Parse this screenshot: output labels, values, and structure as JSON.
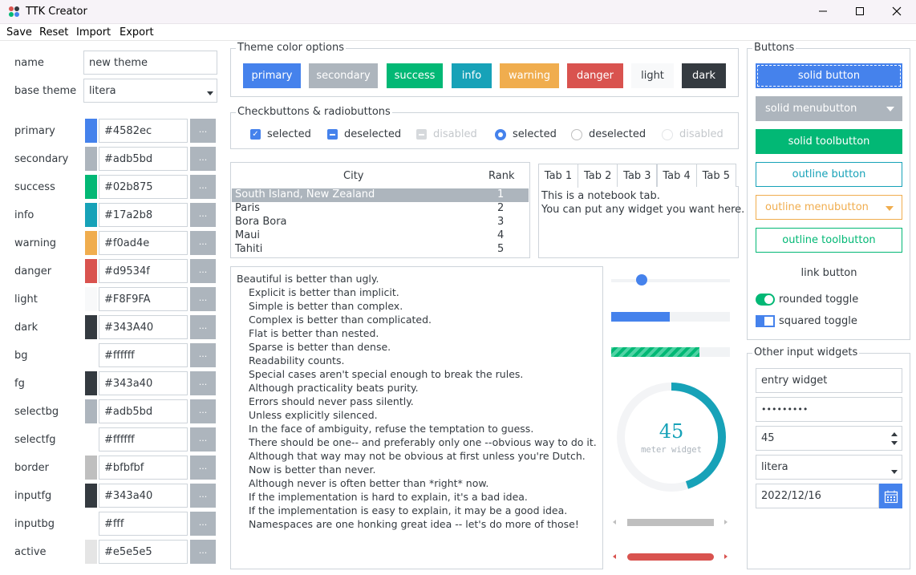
{
  "window": {
    "title": "TTK Creator",
    "icon": "ttk-creator-logo-icon"
  },
  "menu": [
    "Save",
    "Reset",
    "Import",
    "Export"
  ],
  "form": {
    "name_label": "name",
    "name_value": "new theme",
    "base_label": "base theme",
    "base_value": "litera",
    "more_label": "...",
    "colors": [
      {
        "label": "primary",
        "value": "#4582ec",
        "swatch": "#4582ec"
      },
      {
        "label": "secondary",
        "value": "#adb5bd",
        "swatch": "#adb5bd"
      },
      {
        "label": "success",
        "value": "#02b875",
        "swatch": "#02b875"
      },
      {
        "label": "info",
        "value": "#17a2b8",
        "swatch": "#17a2b8"
      },
      {
        "label": "warning",
        "value": "#f0ad4e",
        "swatch": "#f0ad4e"
      },
      {
        "label": "danger",
        "value": "#d9534f",
        "swatch": "#d9534f"
      },
      {
        "label": "light",
        "value": "#F8F9FA",
        "swatch": "#F8F9FA"
      },
      {
        "label": "dark",
        "value": "#343A40",
        "swatch": "#343A40"
      },
      {
        "label": "bg",
        "value": "#ffffff",
        "swatch": "#ffffff"
      },
      {
        "label": "fg",
        "value": "#343a40",
        "swatch": "#343a40"
      },
      {
        "label": "selectbg",
        "value": "#adb5bd",
        "swatch": "#adb5bd"
      },
      {
        "label": "selectfg",
        "value": "#ffffff",
        "swatch": "#ffffff"
      },
      {
        "label": "border",
        "value": "#bfbfbf",
        "swatch": "#bfbfbf"
      },
      {
        "label": "inputfg",
        "value": "#343a40",
        "swatch": "#343a40"
      },
      {
        "label": "inputbg",
        "value": "#fff",
        "swatch": "#ffffff"
      },
      {
        "label": "active",
        "value": "#e5e5e5",
        "swatch": "#e5e5e5"
      }
    ]
  },
  "theme_colors": {
    "title": "Theme color options",
    "buttons": [
      {
        "label": "primary",
        "bg": "#4582ec",
        "fg": "#ffffff"
      },
      {
        "label": "secondary",
        "bg": "#adb5bd",
        "fg": "#ffffff"
      },
      {
        "label": "success",
        "bg": "#02b875",
        "fg": "#ffffff"
      },
      {
        "label": "info",
        "bg": "#17a2b8",
        "fg": "#ffffff"
      },
      {
        "label": "warning",
        "bg": "#f0ad4e",
        "fg": "#ffffff"
      },
      {
        "label": "danger",
        "bg": "#d9534f",
        "fg": "#ffffff"
      },
      {
        "label": "light",
        "bg": "#F8F9FA",
        "fg": "#343a40"
      },
      {
        "label": "dark",
        "bg": "#343A40",
        "fg": "#ffffff"
      }
    ]
  },
  "checks": {
    "title": "Checkbuttons & radiobuttons",
    "items": [
      {
        "label": "selected",
        "state": "checked"
      },
      {
        "label": "deselected",
        "state": "indeterminate"
      },
      {
        "label": "disabled",
        "state": "disabled"
      },
      {
        "label": "selected",
        "state": "radio-on"
      },
      {
        "label": "deselected",
        "state": "radio-off"
      },
      {
        "label": "disabled",
        "state": "radio-disabled"
      }
    ]
  },
  "table": {
    "columns": [
      "City",
      "Rank"
    ],
    "rows": [
      {
        "city": "South Island, New Zealand",
        "rank": "1",
        "selected": true
      },
      {
        "city": "Paris",
        "rank": "2"
      },
      {
        "city": "Bora Bora",
        "rank": "3"
      },
      {
        "city": "Maui",
        "rank": "4"
      },
      {
        "city": "Tahiti",
        "rank": "5"
      }
    ]
  },
  "notebook": {
    "tabs": [
      "Tab 1",
      "Tab 2",
      "Tab 3",
      "Tab 4",
      "Tab 5"
    ],
    "line1": "This is a notebook tab.",
    "line2": "You can put any widget you want here."
  },
  "zen": [
    "Beautiful is better than ugly.",
    "Explicit is better than implicit.",
    "Simple is better than complex.",
    "Complex is better than complicated.",
    "Flat is better than nested.",
    "Sparse is better than dense.",
    "Readability counts.",
    "Special cases aren't special enough to break the rules.",
    "Although practicality beats purity.",
    "Errors should never pass silently.",
    "Unless explicitly silenced.",
    "In the face of ambiguity, refuse the temptation to guess.",
    "There should be one-- and preferably only one --obvious way to do it.",
    "Although that way may not be obvious at first unless you're Dutch.",
    "Now is better than never.",
    "Although never is often better than *right* now.",
    "If the implementation is hard to explain, it's a bad idea.",
    "If the implementation is easy to explain, it may be a good idea.",
    "Namespaces are one honking great idea -- let's do more of those!"
  ],
  "controls": {
    "scale_fraction": 0.26,
    "progress_fraction": 0.49,
    "striped_fraction": 0.74,
    "meter_value": "45",
    "meter_fraction": 0.45,
    "meter_label": "meter widget"
  },
  "buttons_panel": {
    "title": "Buttons",
    "solid_button": "solid button",
    "solid_menubutton": "solid menubutton",
    "solid_toolbutton": "solid toolbutton",
    "outline_button": "outline button",
    "outline_menubutton": "outline menubutton",
    "outline_toolbutton": "outline toolbutton",
    "link_button": "link button",
    "rounded_toggle": "rounded toggle",
    "squared_toggle": "squared toggle"
  },
  "inputs_panel": {
    "title": "Other input widgets",
    "entry": "entry widget",
    "password": "•••••••••",
    "spin": "45",
    "combo": "litera",
    "date": "2022/12/16"
  }
}
